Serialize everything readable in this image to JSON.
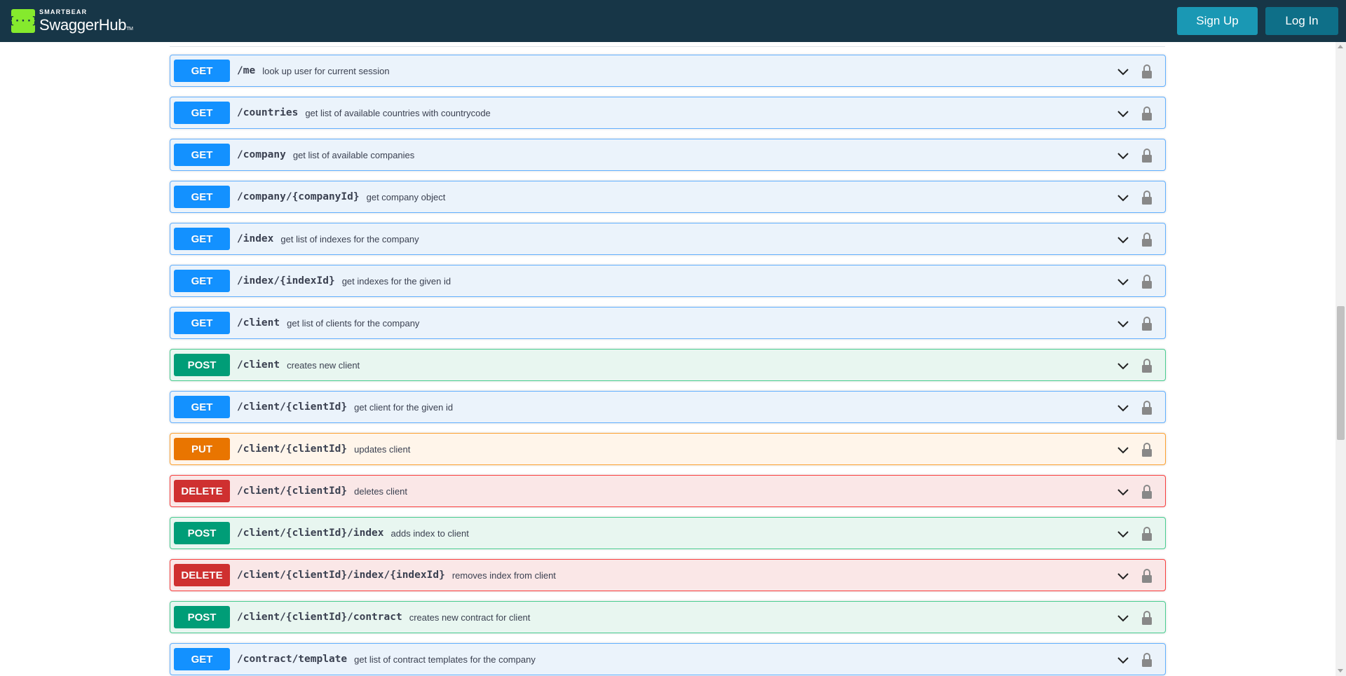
{
  "header": {
    "brand_top": "SMARTBEAR",
    "brand_main": "SwaggerHub",
    "brand_tm": "TM",
    "logo_glyph": "{···}",
    "signup_label": "Sign Up",
    "login_label": "Log In"
  },
  "colors": {
    "header_bg": "#173647",
    "get": "#1391ff",
    "post": "#009d77",
    "put": "#e97500",
    "delete": "#cf3030"
  },
  "operations": [
    {
      "method": "GET",
      "path": "/me",
      "summary": "look up user for current session"
    },
    {
      "method": "GET",
      "path": "/countries",
      "summary": "get list of available countries with countrycode"
    },
    {
      "method": "GET",
      "path": "/company",
      "summary": "get list of available companies"
    },
    {
      "method": "GET",
      "path": "/company/{companyId}",
      "summary": "get company object"
    },
    {
      "method": "GET",
      "path": "/index",
      "summary": "get list of indexes for the company"
    },
    {
      "method": "GET",
      "path": "/index/{indexId}",
      "summary": "get indexes for the given id"
    },
    {
      "method": "GET",
      "path": "/client",
      "summary": "get list of clients for the company"
    },
    {
      "method": "POST",
      "path": "/client",
      "summary": "creates new client"
    },
    {
      "method": "GET",
      "path": "/client/{clientId}",
      "summary": "get client for the given id"
    },
    {
      "method": "PUT",
      "path": "/client/{clientId}",
      "summary": "updates client"
    },
    {
      "method": "DELETE",
      "path": "/client/{clientId}",
      "summary": "deletes client"
    },
    {
      "method": "POST",
      "path": "/client/{clientId}/index",
      "summary": "adds index to client"
    },
    {
      "method": "DELETE",
      "path": "/client/{clientId}/index/{indexId}",
      "summary": "removes index from client"
    },
    {
      "method": "POST",
      "path": "/client/{clientId}/contract",
      "summary": "creates new contract for client"
    },
    {
      "method": "GET",
      "path": "/contract/template",
      "summary": "get list of contract templates for the company"
    }
  ]
}
